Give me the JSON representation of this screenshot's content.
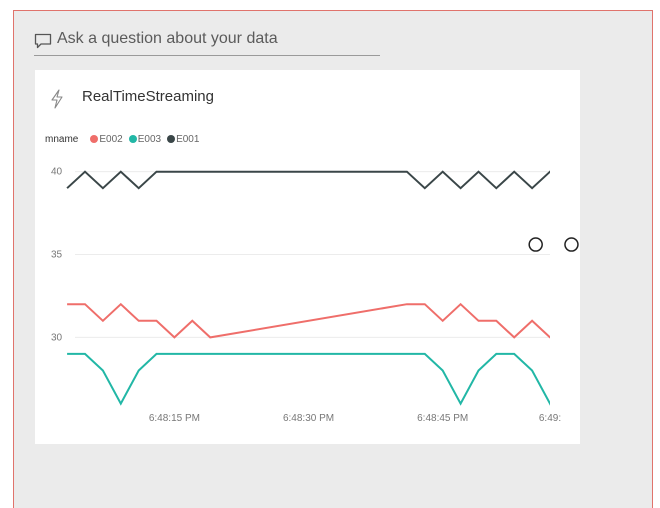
{
  "qna": {
    "placeholder": "Ask a question about your data",
    "icon": "speech-bubble-icon"
  },
  "tile": {
    "title": "RealTimeStreaming",
    "icon": "lightning-bolt-icon"
  },
  "chart_data": {
    "type": "line",
    "legend_title": "mname",
    "legend_placement": "top-left",
    "grid": true,
    "ylim": [
      26.4,
      40.1
    ],
    "y_ticks": [
      30,
      35,
      40
    ],
    "xlim": [
      0,
      26
    ],
    "x_ticks": [
      {
        "x": 5,
        "label": "6:48:15 PM"
      },
      {
        "x": 12.5,
        "label": "6:48:30 PM"
      },
      {
        "x": 20,
        "label": "6:48:45 PM"
      },
      {
        "x": 26,
        "label": "6:49:"
      }
    ],
    "series": [
      {
        "name": "E002",
        "color": "#ef6e6a",
        "points": [
          [
            -1,
            32
          ],
          [
            0,
            32
          ],
          [
            1,
            31
          ],
          [
            2,
            32
          ],
          [
            3,
            31
          ],
          [
            4,
            31
          ],
          [
            5,
            30
          ],
          [
            6,
            31
          ],
          [
            7,
            30
          ],
          [
            18,
            32
          ],
          [
            19,
            32
          ],
          [
            20,
            31
          ],
          [
            21,
            32
          ],
          [
            22,
            31
          ],
          [
            23,
            31
          ],
          [
            24,
            30
          ],
          [
            25,
            31
          ],
          [
            26,
            30
          ],
          [
            27,
            30
          ]
        ]
      },
      {
        "name": "E003",
        "color": "#22b7a6",
        "points": [
          [
            -1,
            29
          ],
          [
            0,
            29
          ],
          [
            1,
            28
          ],
          [
            2,
            26
          ],
          [
            3,
            28
          ],
          [
            4,
            29
          ],
          [
            18,
            29
          ],
          [
            19,
            29
          ],
          [
            20,
            28
          ],
          [
            21,
            26
          ],
          [
            22,
            28
          ],
          [
            23,
            29
          ],
          [
            24,
            29
          ],
          [
            25,
            28
          ],
          [
            26,
            26
          ],
          [
            27,
            28
          ]
        ]
      },
      {
        "name": "E001",
        "color": "#3a4648",
        "points": [
          [
            -1,
            39
          ],
          [
            0,
            40
          ],
          [
            1,
            39
          ],
          [
            2,
            40
          ],
          [
            3,
            39
          ],
          [
            4,
            40
          ],
          [
            18,
            40
          ],
          [
            19,
            39
          ],
          [
            20,
            40
          ],
          [
            21,
            39
          ],
          [
            22,
            40
          ],
          [
            23,
            39
          ],
          [
            24,
            40
          ],
          [
            25,
            39
          ],
          [
            26,
            40
          ],
          [
            27,
            39
          ]
        ],
        "markers": [
          [
            25.2,
            35.6
          ],
          [
            27.2,
            35.6
          ]
        ]
      }
    ]
  }
}
